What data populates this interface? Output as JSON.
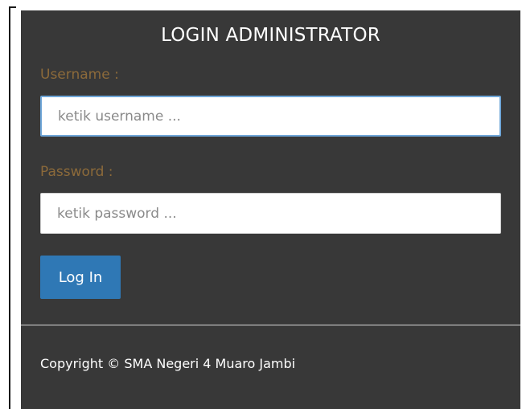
{
  "login_panel": {
    "title": "LOGIN ADMINISTRATOR",
    "username": {
      "label": "Username :",
      "placeholder": "ketik username ...",
      "value": ""
    },
    "password": {
      "label": "Password :",
      "placeholder": "ketik password ...",
      "value": ""
    },
    "login_button_label": "Log In"
  },
  "footer": {
    "copyright": "Copyright © SMA Negeri 4 Muaro Jambi"
  },
  "colors": {
    "panel_background": "#383838",
    "label_color": "#8c6a3a",
    "button_color": "#2f78b5",
    "focus_border": "#6fa6d8"
  }
}
